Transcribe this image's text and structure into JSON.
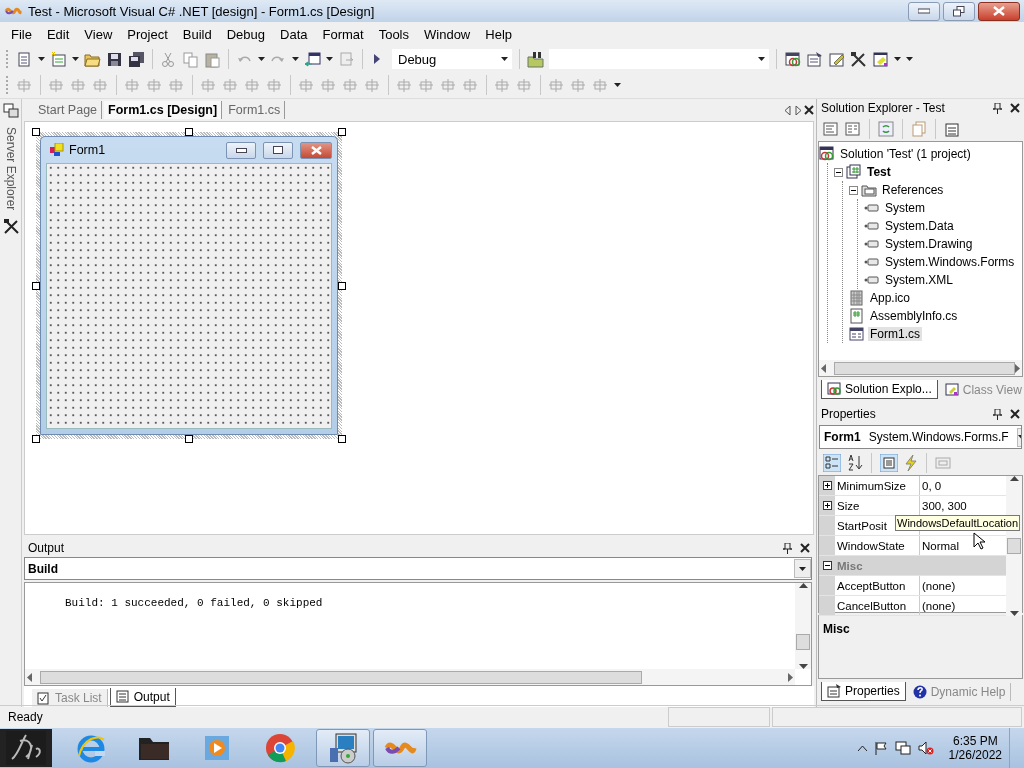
{
  "window": {
    "title": "Test - Microsoft Visual C# .NET [design] - Form1.cs [Design]"
  },
  "menu": [
    {
      "label": "File"
    },
    {
      "label": "Edit"
    },
    {
      "label": "View"
    },
    {
      "label": "Project"
    },
    {
      "label": "Build"
    },
    {
      "label": "Debug"
    },
    {
      "label": "Data"
    },
    {
      "label": "Format"
    },
    {
      "label": "Tools"
    },
    {
      "label": "Window"
    },
    {
      "label": "Help"
    }
  ],
  "toolbar": {
    "configuration": "Debug"
  },
  "side_strip": {
    "label": "Server Explorer"
  },
  "document_tabs": [
    {
      "label": "Start Page",
      "selected": false
    },
    {
      "label": "Form1.cs [Design]",
      "selected": true
    },
    {
      "label": "Form1.cs",
      "selected": false
    }
  ],
  "designer_form": {
    "title": "Form1"
  },
  "output": {
    "title": "Output",
    "source": "Build",
    "text": "Build: 1 succeeded, 0 failed, 0 skipped",
    "tabs": [
      {
        "label": "Task List",
        "kind": "tasks",
        "selected": false
      },
      {
        "label": "Output",
        "kind": "output",
        "selected": true
      }
    ]
  },
  "solution_explorer": {
    "title": "Solution Explorer - Test",
    "tree": [
      {
        "label": "Solution 'Test' (1 project)",
        "kind": "solution",
        "selected": false,
        "children": [
          {
            "label": "Test",
            "kind": "project",
            "selected": false,
            "expanded": true,
            "children": [
              {
                "label": "References",
                "kind": "folder",
                "selected": false,
                "expanded": true,
                "children": [
                  {
                    "label": "System",
                    "kind": "reference",
                    "selected": false
                  },
                  {
                    "label": "System.Data",
                    "kind": "reference",
                    "selected": false
                  },
                  {
                    "label": "System.Drawing",
                    "kind": "reference",
                    "selected": false
                  },
                  {
                    "label": "System.Windows.Forms",
                    "kind": "reference",
                    "selected": false
                  },
                  {
                    "label": "System.XML",
                    "kind": "reference",
                    "selected": false
                  }
                ]
              },
              {
                "label": "App.ico",
                "kind": "icon-file",
                "selected": false
              },
              {
                "label": "AssemblyInfo.cs",
                "kind": "code-file",
                "selected": false
              },
              {
                "label": "Form1.cs",
                "kind": "form-file",
                "selected": true
              }
            ]
          }
        ]
      }
    ],
    "tabs": [
      {
        "label": "Solution Explo...",
        "kind": "solution",
        "selected": true
      },
      {
        "label": "Class View",
        "kind": "classes",
        "selected": false
      }
    ]
  },
  "properties": {
    "title": "Properties",
    "object": "Form1",
    "object_type": "System.Windows.Forms.F",
    "rows": [
      {
        "kind": "group",
        "name": "MinimumSize",
        "value": "0, 0",
        "expanded": false
      },
      {
        "kind": "group",
        "name": "Size",
        "value": "300, 300",
        "expanded": false
      },
      {
        "kind": "property",
        "name": "StartPosit"
      },
      {
        "kind": "property",
        "name": "WindowState",
        "value": "Normal"
      },
      {
        "kind": "category",
        "name": "Misc",
        "expanded": true
      },
      {
        "kind": "property",
        "name": "AcceptButton",
        "value": "(none)"
      },
      {
        "kind": "property",
        "name": "CancelButton",
        "value": "(none)"
      }
    ],
    "tooltip": "WindowsDefaultLocation",
    "description_title": "Misc",
    "tabs": [
      {
        "label": "Properties",
        "kind": "properties",
        "selected": true
      },
      {
        "label": "Dynamic Help",
        "kind": "help",
        "selected": false
      }
    ]
  },
  "status_bar": {
    "text": "Ready"
  },
  "taskbar": {
    "items": [
      {
        "kind": "start",
        "running": false
      },
      {
        "kind": "browser",
        "running": false
      },
      {
        "kind": "folder",
        "running": false
      },
      {
        "kind": "player",
        "running": false
      },
      {
        "kind": "ball",
        "running": false
      },
      {
        "kind": "setup",
        "running": true
      },
      {
        "kind": "infinity",
        "running": true
      }
    ],
    "time": "6:35 PM",
    "date": "1/26/2022"
  }
}
